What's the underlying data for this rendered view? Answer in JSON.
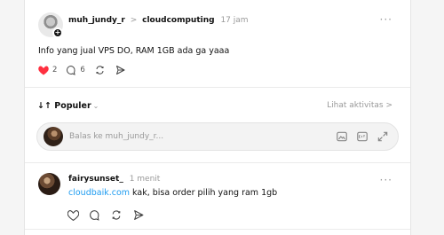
{
  "post": {
    "author": "muh_jundy_r",
    "separator": ">",
    "community": "cloudcomputing",
    "time": "17 jam",
    "more": "···",
    "text": "Info yang jual VPS DO, RAM 1GB ada ga yaaa",
    "likes": "2",
    "comments": "6",
    "icons": {
      "like": "heart-icon",
      "comment": "comment-icon",
      "repost": "repost-icon",
      "share": "send-icon"
    }
  },
  "sort": {
    "label": "↓↑ Populer",
    "chevron": "⌄",
    "activity": "Lihat aktivitas >"
  },
  "reply": {
    "placeholder": "Balas ke muh_jundy_r...",
    "icons": [
      "image-icon",
      "gif-icon",
      "expand-icon"
    ]
  },
  "comment": {
    "author": "fairysunset_",
    "time": "1 menit",
    "more": "···",
    "link": "cloudbaik.com",
    "text": " kak, bisa order pilih yang ram 1gb"
  },
  "colors": {
    "heart": "#ff3040",
    "link": "#1d9bf0",
    "muted": "#999999"
  }
}
